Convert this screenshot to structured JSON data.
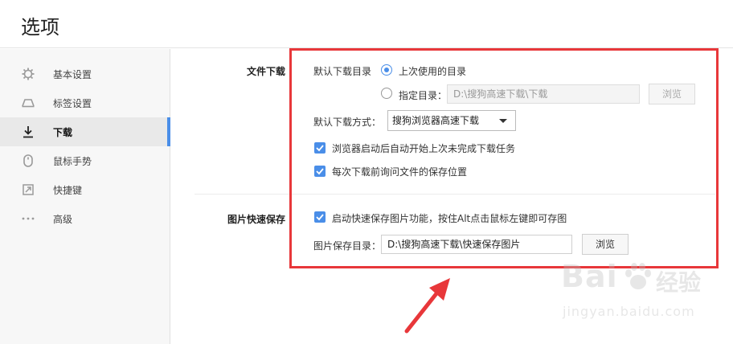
{
  "window": {
    "title": "选项"
  },
  "sidebar": {
    "items": [
      {
        "label": "基本设置",
        "icon": "gear-icon"
      },
      {
        "label": "标签设置",
        "icon": "tab-icon"
      },
      {
        "label": "下载",
        "icon": "download-icon",
        "active": true
      },
      {
        "label": "鼠标手势",
        "icon": "mouse-icon"
      },
      {
        "label": "快捷键",
        "icon": "shortcut-icon"
      },
      {
        "label": "高级",
        "icon": "more-dots-icon"
      }
    ]
  },
  "download": {
    "section_label": "文件下载",
    "default_dir_label": "默认下载目录",
    "radio_last_used": "上次使用的目录",
    "radio_specify": "指定目录：",
    "specify_path": "D:\\搜狗高速下载\\下载",
    "browse_label": "浏览",
    "method_label": "默认下载方式：",
    "method_value": "搜狗浏览器高速下载",
    "check_resume": "浏览器启动后自动开始上次未完成下载任务",
    "check_ask": "每次下载前询问文件的保存位置"
  },
  "image_save": {
    "section_label": "图片快速保存",
    "check_enable": "启动快速保存图片功能，按住Alt点击鼠标左键即可存图",
    "dir_label": "图片保存目录：",
    "dir_path": "D:\\搜狗高速下载\\快速保存图片",
    "browse_label": "浏览"
  },
  "watermark": {
    "logo_text": "Bai",
    "logo_suffix": "经验",
    "url": "jingyan.baidu.com"
  },
  "colors": {
    "accent": "#4a8ee8",
    "highlight": "#e8373a"
  }
}
